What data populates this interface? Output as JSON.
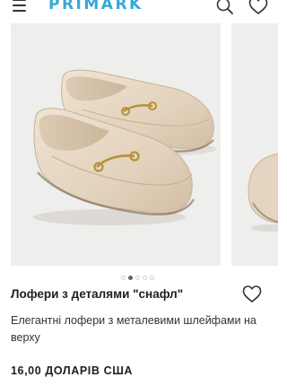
{
  "header": {
    "brand": "PRIMARK",
    "menu_icon": "hamburger-menu-icon",
    "search_icon": "search-icon",
    "wishlist_icon": "heart-icon"
  },
  "gallery": {
    "image_subject": "beige loafers with gold horsebit detail",
    "dot_count": 5,
    "active_index": 1
  },
  "product": {
    "title": "Лофери з деталями \"снафл\"",
    "description": "Елегантні лофери з металевими шлейфами на верху",
    "price": "16,00 ДОЛАРІВ США",
    "favorite_icon": "heart-icon"
  },
  "colors": {
    "brand": "#35a8da",
    "image_bg": "#eeeeec",
    "text": "#1e1e1e"
  }
}
